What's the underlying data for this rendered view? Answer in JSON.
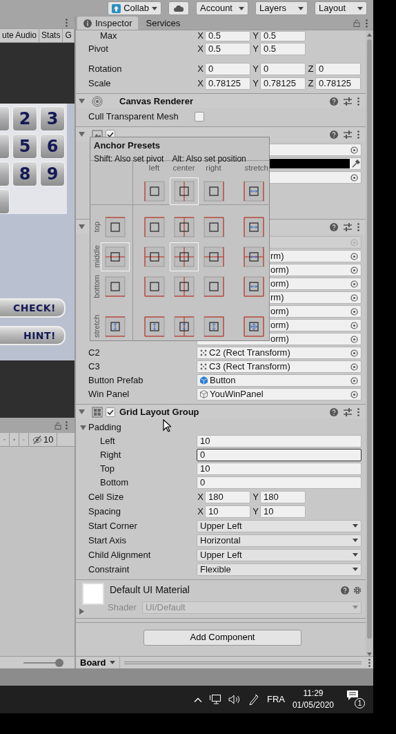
{
  "toolbar": {
    "buttons": [
      {
        "kind": "collab",
        "label": "Collab"
      },
      {
        "kind": "cloud"
      },
      {
        "kind": "menu",
        "label": "Account"
      },
      {
        "kind": "menu",
        "label": "Layers"
      },
      {
        "kind": "menu",
        "label": "Layout"
      }
    ]
  },
  "game_view": {
    "toolbar": [
      "ute Audio",
      "Stats",
      "G"
    ],
    "tile_rows": [
      [
        {
          "kind": "cut"
        },
        {
          "kind": "number",
          "label": "2"
        },
        {
          "kind": "number",
          "label": "3"
        }
      ],
      [
        {
          "kind": "cut"
        },
        {
          "kind": "number",
          "label": "5"
        },
        {
          "kind": "number",
          "label": "6"
        }
      ],
      [
        {
          "kind": "cut"
        },
        {
          "kind": "number",
          "label": "8"
        },
        {
          "kind": "number",
          "label": "9"
        }
      ],
      [
        {
          "kind": "cut"
        }
      ]
    ],
    "buttons": [
      "CHECK!",
      "HINT!"
    ]
  },
  "project_panel": {
    "hidden_count": "10",
    "zoom": {
      "level": 1
    }
  },
  "inspector": {
    "tabs": [
      {
        "label": "Inspector",
        "selected": true
      },
      {
        "label": "Services",
        "selected": false
      }
    ],
    "components": [
      {
        "kind": "transform",
        "rows": [
          {
            "kind": "vec2",
            "label": "Max",
            "indent": true,
            "fields": [
              {
                "axis": "X",
                "value": "0.5"
              },
              {
                "axis": "Y",
                "value": "0.5"
              }
            ]
          },
          {
            "kind": "vec2",
            "label": "Pivot",
            "indent": false,
            "fields": [
              {
                "axis": "X",
                "value": "0.5"
              },
              {
                "axis": "Y",
                "value": "0.5"
              }
            ]
          },
          {
            "kind": "vec3",
            "label": "Rotation",
            "fields": [
              {
                "axis": "X",
                "value": "0"
              },
              {
                "axis": "Y",
                "value": "0"
              },
              {
                "axis": "Z",
                "value": "0"
              }
            ]
          },
          {
            "kind": "vec3",
            "label": "Scale",
            "fields": [
              {
                "axis": "X",
                "value": "0.78125"
              },
              {
                "axis": "Y",
                "value": "0.78125"
              },
              {
                "axis": "Z",
                "value": "0.78125"
              }
            ]
          }
        ]
      },
      {
        "kind": "canvas_renderer",
        "header": {
          "title": "Canvas Renderer",
          "expanded": true
        },
        "rows": [
          {
            "kind": "check",
            "label": "Cull Transparent Mesh",
            "checked": false
          }
        ]
      },
      {
        "kind": "image",
        "header": {
          "checked": true,
          "expanded": true
        },
        "rows": [
          {
            "kind": "object"
          },
          {
            "kind": "color",
            "color": "#000000"
          },
          {
            "kind": "object"
          }
        ]
      },
      {
        "kind": "script",
        "header": {
          "expanded": true
        },
        "rows": [
          {
            "kind": "script"
          },
          {
            "kind": "object",
            "value": "rm)",
            "covered": true
          },
          {
            "kind": "object",
            "value": "orm)",
            "covered": true
          },
          {
            "kind": "object",
            "value": "orm)",
            "covered": true
          },
          {
            "kind": "object",
            "value": "rm)",
            "covered": true
          },
          {
            "kind": "object",
            "value": "orm)",
            "covered": true
          },
          {
            "kind": "object",
            "value": "orm)",
            "covered": true
          },
          {
            "kind": "object",
            "value": "orm)",
            "covered": true
          },
          {
            "kind": "rect_object",
            "label": "C2",
            "value": "C2 (Rect Transform)"
          },
          {
            "kind": "rect_object",
            "label": "C3",
            "value": "C3 (Rect Transform)"
          },
          {
            "kind": "prefab_object",
            "label": "Button Prefab",
            "value": "Button"
          },
          {
            "kind": "asset_object",
            "label": "Win Panel",
            "value": "YouWinPanel"
          }
        ]
      },
      {
        "kind": "grid",
        "header": {
          "checked": true,
          "title": "Grid Layout Group",
          "expanded": true
        },
        "rows": [
          {
            "kind": "foldout",
            "label": "Padding",
            "expanded": true
          },
          {
            "kind": "text",
            "label": "Left",
            "indent": true,
            "value": "10",
            "focused": false
          },
          {
            "kind": "text",
            "label": "Right",
            "indent": true,
            "value": "0",
            "focused": true
          },
          {
            "kind": "text",
            "label": "Top",
            "indent": true,
            "value": "10",
            "focused": false
          },
          {
            "kind": "text",
            "label": "Bottom",
            "indent": true,
            "value": "0",
            "focused": false
          },
          {
            "kind": "vec2",
            "label": "Cell Size",
            "indent": false,
            "fields": [
              {
                "axis": "X",
                "value": "180"
              },
              {
                "axis": "Y",
                "value": "180"
              }
            ]
          },
          {
            "kind": "vec2",
            "label": "Spacing",
            "indent": false,
            "fields": [
              {
                "axis": "X",
                "value": "10"
              },
              {
                "axis": "Y",
                "value": "10"
              }
            ]
          },
          {
            "kind": "dropdown",
            "label": "Start Corner",
            "value": "Upper Left"
          },
          {
            "kind": "dropdown",
            "label": "Start Axis",
            "value": "Horizontal"
          },
          {
            "kind": "dropdown",
            "label": "Child Alignment",
            "value": "Upper Left"
          },
          {
            "kind": "dropdown",
            "label": "Constraint",
            "value": "Flexible"
          }
        ]
      },
      {
        "kind": "material",
        "title": "Default UI Material",
        "shader_label": "Shader",
        "shader": "UI/Default",
        "expanded": false
      }
    ],
    "add_component": "Add Component",
    "footer": {
      "label": "Board"
    }
  },
  "anchor_presets": {
    "title": "Anchor Presets",
    "hints": [
      "Shift: Also set pivot",
      "Alt: Also set position"
    ],
    "columns": [
      {
        "label": "left",
        "selected": false
      },
      {
        "label": "center",
        "selected": true
      },
      {
        "label": "right",
        "selected": false
      },
      {
        "label": "stretch",
        "selected": false
      }
    ],
    "rows": [
      {
        "label": "top",
        "selected": false,
        "cells": [
          {
            "selected": false
          },
          {
            "selected": false
          },
          {
            "selected": false
          },
          {
            "selected": false
          }
        ]
      },
      {
        "label": "middle",
        "selected": true,
        "cells": [
          {
            "selected": false
          },
          {
            "selected": true
          },
          {
            "selected": false
          },
          {
            "selected": false
          }
        ]
      },
      {
        "label": "bottom",
        "selected": false,
        "cells": [
          {
            "selected": false
          },
          {
            "selected": false
          },
          {
            "selected": false
          },
          {
            "selected": false
          }
        ]
      },
      {
        "label": "stretch",
        "selected": false,
        "cells": [
          {
            "selected": false
          },
          {
            "selected": false
          },
          {
            "selected": false
          },
          {
            "selected": false
          }
        ]
      }
    ]
  },
  "taskbar": {
    "language": "FRA",
    "time": "11:29",
    "date": "01/05/2020",
    "notifications": "1"
  }
}
